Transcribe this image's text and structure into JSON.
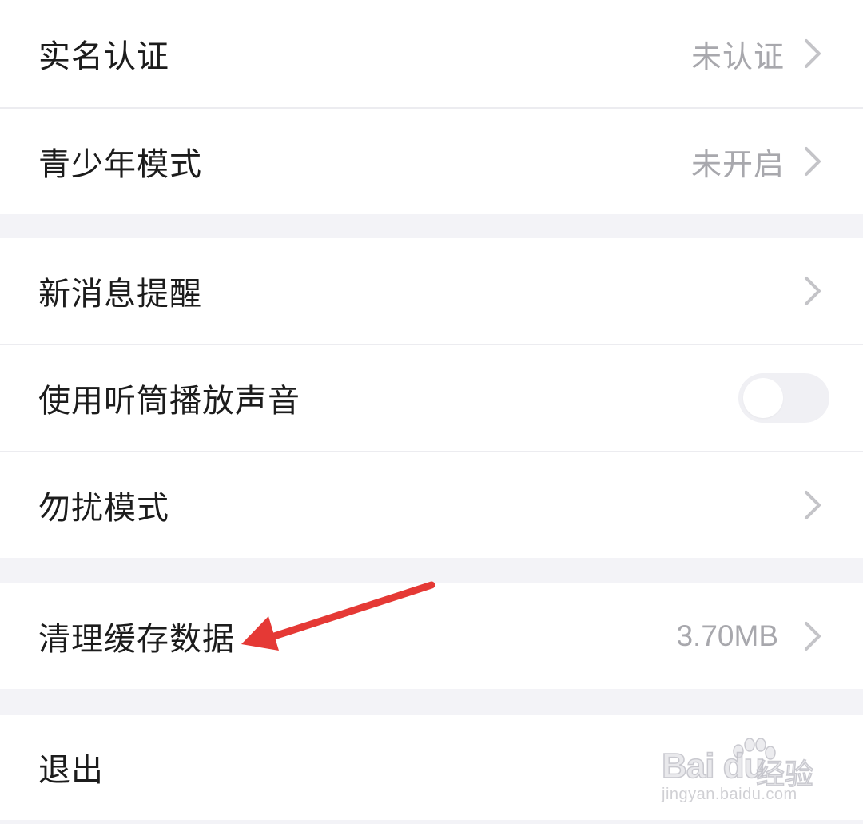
{
  "settings": {
    "realname": {
      "label": "实名认证",
      "value": "未认证"
    },
    "teen_mode": {
      "label": "青少年模式",
      "value": "未开启"
    },
    "new_message": {
      "label": "新消息提醒"
    },
    "earpiece": {
      "label": "使用听筒播放声音",
      "toggle_on": false
    },
    "dnd": {
      "label": "勿扰模式"
    },
    "clear_cache": {
      "label": "清理缓存数据",
      "value": "3.70MB"
    },
    "logout": {
      "label": "退出"
    }
  },
  "annotation": {
    "arrow_color": "#e53935"
  },
  "watermark": {
    "logo_text": "Bai du",
    "logo_cn": "经验",
    "url": "jingyan.baidu.com"
  },
  "colors": {
    "background": "#f3f3f7",
    "row": "#ffffff",
    "text": "#1c1c1c",
    "secondary_text": "#a8a8ad",
    "chevron": "#c4c4c8"
  }
}
